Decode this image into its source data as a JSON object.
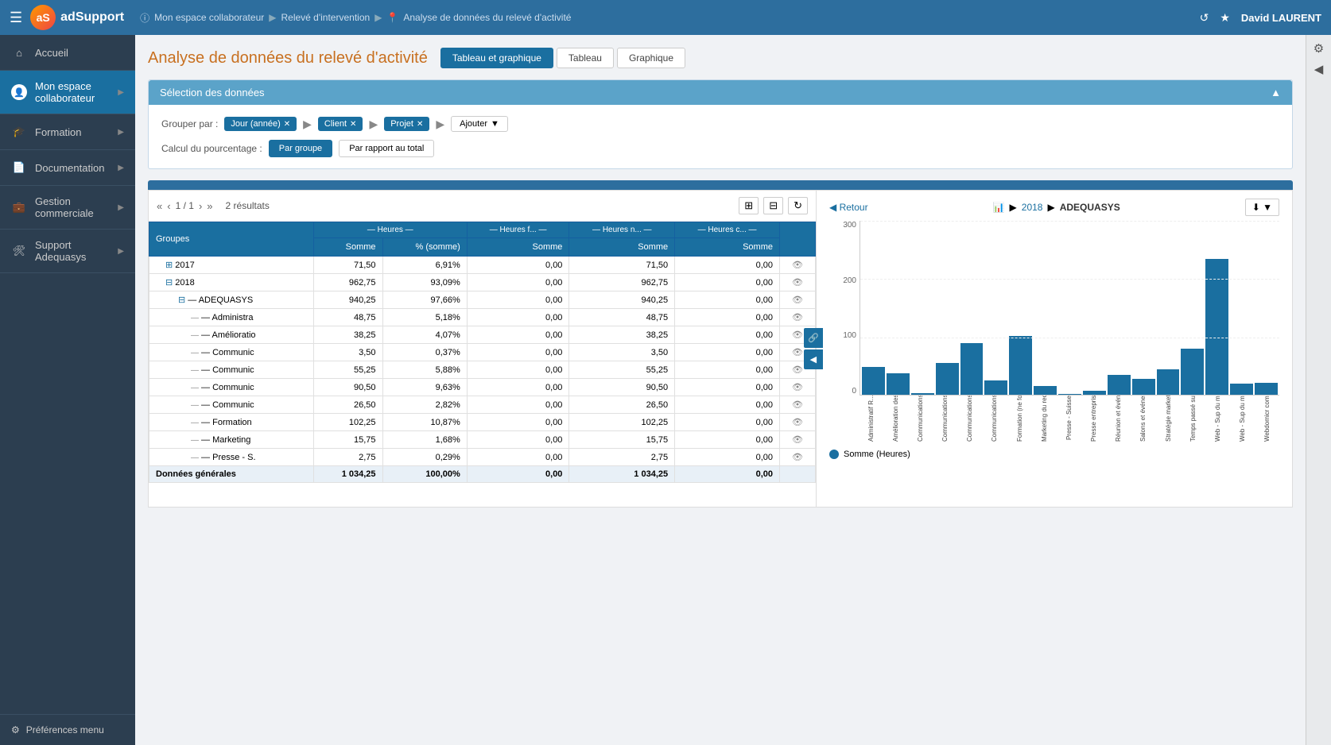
{
  "app": {
    "name": "adSupport",
    "logo_text": "aS"
  },
  "topbar": {
    "breadcrumb": [
      {
        "text": "Mon espace collaborateur",
        "icon": "ⓘ"
      },
      {
        "text": "Relevé d'intervention"
      },
      {
        "text": "Analyse de données du relevé d'activité",
        "icon": "📍"
      }
    ],
    "user": "David LAURENT",
    "history_icon": "↺",
    "star_icon": "★"
  },
  "sidebar": {
    "items": [
      {
        "label": "Accueil",
        "icon": "⌂",
        "active": false,
        "has_arrow": false
      },
      {
        "label": "Mon espace collaborateur",
        "icon": "👤",
        "active": true,
        "has_arrow": true
      },
      {
        "label": "Formation",
        "icon": "🎓",
        "active": false,
        "has_arrow": true
      },
      {
        "label": "Documentation",
        "icon": "📄",
        "active": false,
        "has_arrow": true
      },
      {
        "label": "Gestion commerciale",
        "icon": "💼",
        "active": false,
        "has_arrow": true
      },
      {
        "label": "Support Adequasys",
        "icon": "🛠",
        "active": false,
        "has_arrow": true
      }
    ],
    "footer": {
      "label": "Préférences menu",
      "icon": "⚙"
    }
  },
  "page": {
    "title": "Analyse de données du relevé d'activité",
    "view_tabs": [
      {
        "label": "Tableau et graphique",
        "active": true
      },
      {
        "label": "Tableau",
        "active": false
      },
      {
        "label": "Graphique",
        "active": false
      }
    ]
  },
  "selection": {
    "header": "Sélection des données",
    "group_label": "Grouper par :",
    "groups": [
      {
        "label": "Jour (année)"
      },
      {
        "label": "Client"
      },
      {
        "label": "Projet"
      }
    ],
    "add_label": "Ajouter",
    "pct_label": "Calcul du pourcentage :",
    "pct_options": [
      {
        "label": "Par groupe",
        "active": true
      },
      {
        "label": "Par rapport au total",
        "active": false
      }
    ]
  },
  "pagination": {
    "current": "1 / 1",
    "results": "2 résultats"
  },
  "table": {
    "col_headers_main": [
      "Heures",
      "Heures f...",
      "Heures n...",
      "Heures c..."
    ],
    "col_headers_sub": [
      "Groupes",
      "Somme",
      "% (somme)",
      "Somme",
      "Somme",
      "Somme"
    ],
    "rows": [
      {
        "indent": 1,
        "expandable": true,
        "label": "2017",
        "somme1": "71,50",
        "pct": "6,91%",
        "somme2": "0,00",
        "somme3": "71,50",
        "somme4": "0,00",
        "eye": true
      },
      {
        "indent": 1,
        "expandable": true,
        "label": "2018",
        "somme1": "962,75",
        "pct": "93,09%",
        "somme2": "0,00",
        "somme3": "962,75",
        "somme4": "0,00",
        "eye": true
      },
      {
        "indent": 2,
        "expandable": true,
        "label": "ADEQUASYS",
        "somme1": "940,25",
        "pct": "97,66%",
        "somme2": "0,00",
        "somme3": "940,25",
        "somme4": "0,00",
        "eye": true
      },
      {
        "indent": 3,
        "expandable": false,
        "label": "Administra",
        "somme1": "48,75",
        "pct": "5,18%",
        "somme2": "0,00",
        "somme3": "48,75",
        "somme4": "0,00",
        "eye": true
      },
      {
        "indent": 3,
        "expandable": false,
        "label": "Amélioratio",
        "somme1": "38,25",
        "pct": "4,07%",
        "somme2": "0,00",
        "somme3": "38,25",
        "somme4": "0,00",
        "eye": true
      },
      {
        "indent": 3,
        "expandable": false,
        "label": "Communic",
        "somme1": "3,50",
        "pct": "0,37%",
        "somme2": "0,00",
        "somme3": "3,50",
        "somme4": "0,00",
        "eye": true
      },
      {
        "indent": 3,
        "expandable": false,
        "label": "Communic",
        "somme1": "55,25",
        "pct": "5,88%",
        "somme2": "0,00",
        "somme3": "55,25",
        "somme4": "0,00",
        "eye": true
      },
      {
        "indent": 3,
        "expandable": false,
        "label": "Communic",
        "somme1": "90,50",
        "pct": "9,63%",
        "somme2": "0,00",
        "somme3": "90,50",
        "somme4": "0,00",
        "eye": true
      },
      {
        "indent": 3,
        "expandable": false,
        "label": "Communic",
        "somme1": "26,50",
        "pct": "2,82%",
        "somme2": "0,00",
        "somme3": "26,50",
        "somme4": "0,00",
        "eye": true
      },
      {
        "indent": 3,
        "expandable": false,
        "label": "Formation",
        "somme1": "102,25",
        "pct": "10,87%",
        "somme2": "0,00",
        "somme3": "102,25",
        "somme4": "0,00",
        "eye": true
      },
      {
        "indent": 3,
        "expandable": false,
        "label": "Marketing",
        "somme1": "15,75",
        "pct": "1,68%",
        "somme2": "0,00",
        "somme3": "15,75",
        "somme4": "0,00",
        "eye": true
      },
      {
        "indent": 3,
        "expandable": false,
        "label": "Presse - S.",
        "somme1": "2,75",
        "pct": "0,29%",
        "somme2": "0,00",
        "somme3": "2,75",
        "somme4": "0,00",
        "eye": true
      }
    ],
    "total_row": {
      "label": "Données générales",
      "somme1": "1 034,25",
      "pct": "100,00%",
      "somme2": "0,00",
      "somme3": "1 034,25",
      "somme4": "0,00"
    }
  },
  "chart": {
    "back_label": "Retour",
    "breadcrumb": [
      "2018",
      "ADEQUASYS"
    ],
    "y_labels": [
      "0",
      "100",
      "200",
      "300"
    ],
    "bars": [
      {
        "label": "Administratif R...",
        "value": 48.75
      },
      {
        "label": "Amélioration des outils intern...",
        "value": 38.25
      },
      {
        "label": "Communications intern...",
        "value": 3.5
      },
      {
        "label": "Communications diver...",
        "value": 55.25
      },
      {
        "label": "Communications diver...",
        "value": 90.5
      },
      {
        "label": "Communications diver...",
        "value": 26.5
      },
      {
        "label": "Formation (ne forme)",
        "value": 102.25
      },
      {
        "label": "Marketing du recrute...",
        "value": 15.75
      },
      {
        "label": "Presse - Suisse",
        "value": 2.75
      },
      {
        "label": "Presse entreprise, a...",
        "value": 8.5
      },
      {
        "label": "Réunion et événements",
        "value": 35
      },
      {
        "label": "Salons et événements",
        "value": 28
      },
      {
        "label": "Stratégie marketing",
        "value": 45
      },
      {
        "label": "Temps passé sur des...",
        "value": 80
      },
      {
        "label": "Web - Sup du mois",
        "value": 235
      },
      {
        "label": "Web - Sup du mois...",
        "value": 20
      },
      {
        "label": "Webdomicr commerci...",
        "value": 22
      }
    ],
    "max_value": 300,
    "legend_label": "Somme (Heures)"
  }
}
